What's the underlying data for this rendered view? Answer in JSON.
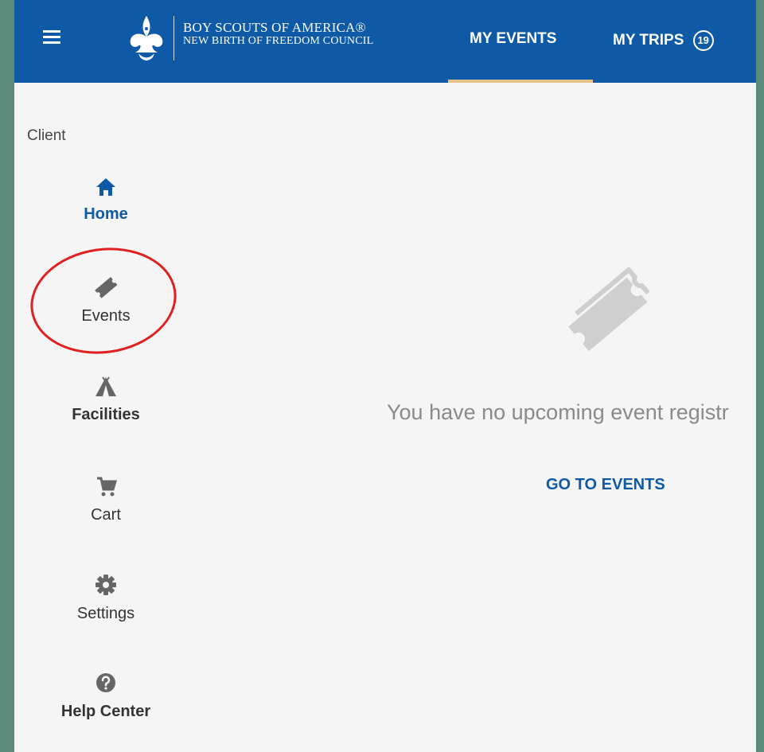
{
  "header": {
    "org_line1": "BOY SCOUTS OF AMERICA®",
    "org_line2": "NEW BIRTH OF FREEDOM COUNCIL",
    "tabs": [
      {
        "label": "MY EVENTS",
        "active": true
      },
      {
        "label": "MY TRIPS",
        "badge": "19"
      }
    ],
    "accent_color": "#0f5aa6",
    "underline_color": "#e6c28a"
  },
  "sidebar": {
    "section_label": "Client",
    "items": [
      {
        "label": "Home",
        "icon": "home-icon",
        "active": true
      },
      {
        "label": "Events",
        "icon": "ticket-icon"
      },
      {
        "label": "Facilities",
        "icon": "tent-icon"
      },
      {
        "label": "Cart",
        "icon": "cart-icon"
      },
      {
        "label": "Settings",
        "icon": "gear-icon"
      },
      {
        "label": "Help Center",
        "icon": "help-icon"
      }
    ]
  },
  "main": {
    "empty_icon": "ticket-icon",
    "empty_message": "You have no upcoming event registr",
    "action_label": "GO TO EVENTS"
  },
  "annotation": {
    "color": "#e02020"
  }
}
